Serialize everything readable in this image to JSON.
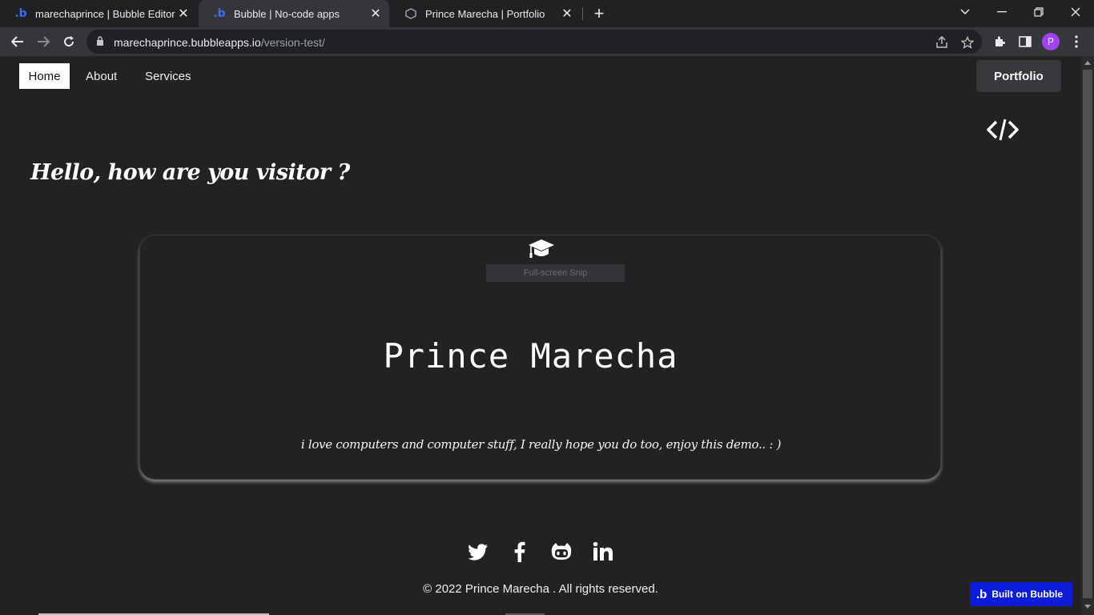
{
  "browser": {
    "tabs": [
      {
        "title": "marechaprince | Bubble Editor",
        "favicon": "bubble-logo-icon",
        "active": false
      },
      {
        "title": "Bubble | No-code apps",
        "favicon": "bubble-logo-icon",
        "active": true
      },
      {
        "title": "Prince Marecha | Portfolio",
        "favicon": "page-icon",
        "active": false
      }
    ],
    "url_host": "marechaprince.bubbleapps.io",
    "url_path": "/version-test/",
    "profile_initial": "P"
  },
  "nav": {
    "home": "Home",
    "about": "About",
    "services": "Services",
    "portfolio": "Portfolio"
  },
  "hero": {
    "greeting": "Hello, how are you visitor ?",
    "snip_overlay": "Full-screen Snip",
    "name": "Prince Marecha",
    "tagline": "i love computers and computer stuff, I really hope you do too, enjoy this demo.. : )"
  },
  "social": [
    "twitter-icon",
    "facebook-icon",
    "github-icon",
    "linkedin-icon"
  ],
  "footer": {
    "copyright": "© 2022 Prince Marecha . All rights reserved.",
    "badge": "Built on Bubble"
  },
  "colors": {
    "page_bg": "#242220",
    "badge_bg": "#0b1bd8",
    "profile_bg": "#a142f4"
  }
}
